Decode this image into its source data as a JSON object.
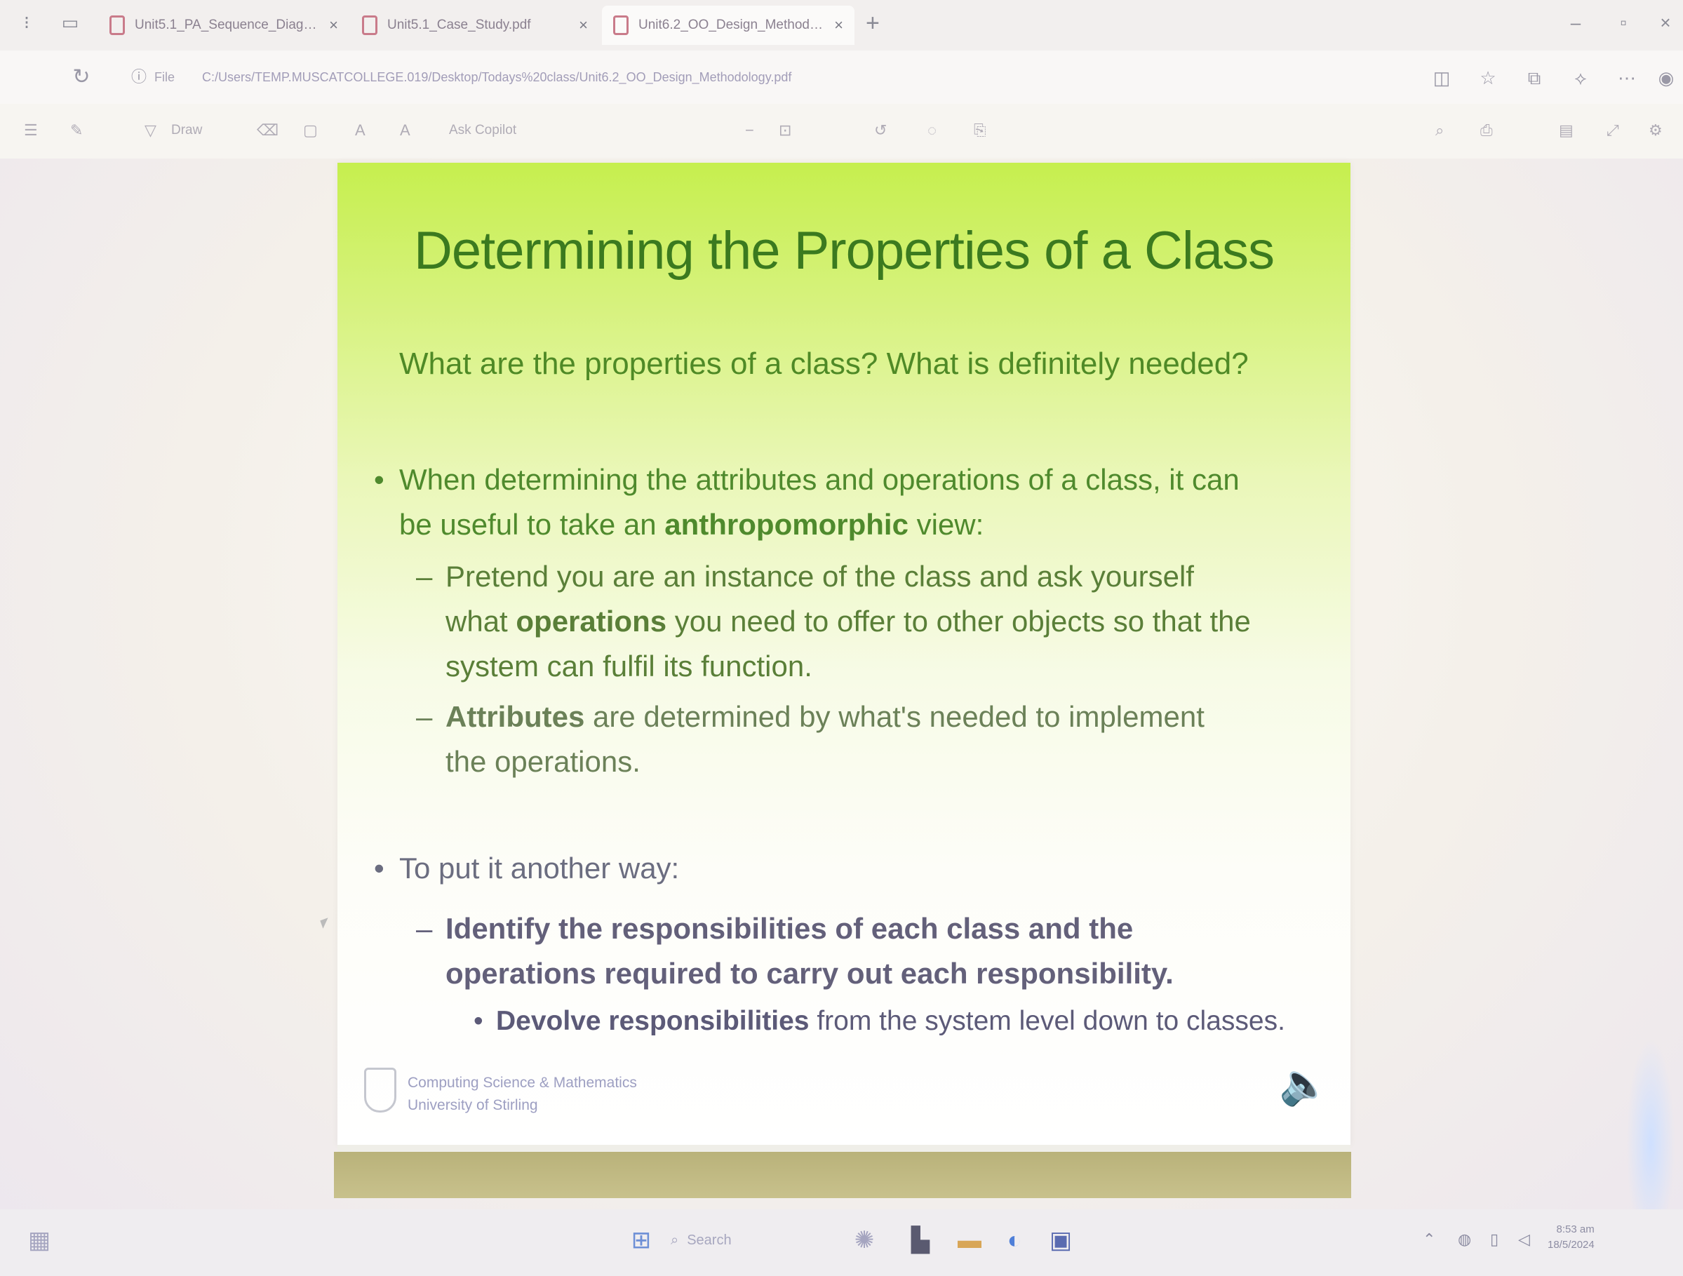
{
  "browser": {
    "tabs": [
      {
        "label": "Unit5.1_PA_Sequence_Diagram...",
        "active": false
      },
      {
        "label": "Unit5.1_Case_Study.pdf",
        "active": false
      },
      {
        "label": "Unit6.2_OO_Design_Methodolo...",
        "active": true
      }
    ],
    "address": {
      "scheme": "File",
      "url": "C:/Users/TEMP.MUSCATCOLLEGE.019/Desktop/Todays%20class/Unit6.2_OO_Design_Methodology.pdf"
    }
  },
  "pdf_toolbar": {
    "draw_label": "Draw",
    "text_size_label": "A",
    "read_aloud_label": "A",
    "ask_copilot_label": "Ask Copilot"
  },
  "slide": {
    "title": "Determining the Properties of a Class",
    "question": "What are the properties of a class? What is definitely needed?",
    "bullet1": {
      "pre": "When determining the attributes and operations of a class, it can be useful to take an ",
      "bold": "anthropomorphic",
      "post": " view:"
    },
    "bullet1_sub1": {
      "pre": "Pretend you are an instance of the class and ask yourself what ",
      "bold": "operations",
      "post": " you need to offer to other objects so that the system can fulfil its function."
    },
    "bullet1_sub2": {
      "bold": "Attributes",
      "post": " are determined by what's needed to implement the operations."
    },
    "bullet2": "To put it another way:",
    "bullet2_sub1": "Identify the responsibilities of each class and the operations required to carry out each responsibility.",
    "bullet2_sub1_item": {
      "bold": "Devolve responsibilities",
      "post": " from the system level down to classes."
    },
    "footer_line1": "Computing Science & Mathematics",
    "footer_line2": "University of Stirling",
    "bullet_mark": "•",
    "dash_mark": "–"
  },
  "taskbar": {
    "search_placeholder": "Search",
    "clock_time": "8:53 am",
    "clock_date": "18/5/2024"
  }
}
